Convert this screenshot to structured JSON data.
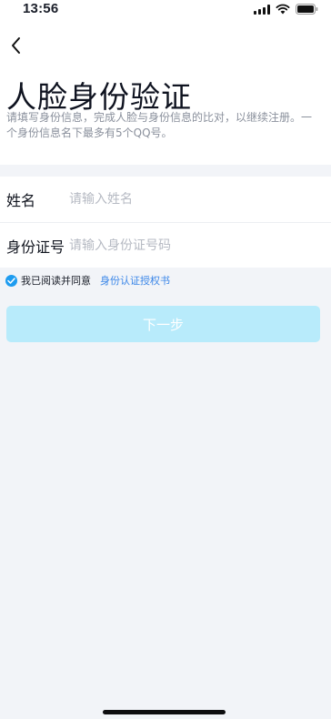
{
  "status_bar": {
    "time": "13:56",
    "icons": [
      "signal-icon",
      "wifi-icon",
      "battery-icon"
    ]
  },
  "header": {
    "back_icon": "chevron-left-icon",
    "title": "人脸身份验证",
    "description": "请填写身份信息，完成人脸与身份信息的比对，以继续注册。一个身份信息名下最多有5个QQ号。"
  },
  "form": {
    "name": {
      "label": "姓名",
      "placeholder": "请输入姓名",
      "value": ""
    },
    "id_number": {
      "label": "身份证号",
      "placeholder": "请输入身份证号码",
      "value": ""
    }
  },
  "agreement": {
    "checked": true,
    "text": "我已阅读并同意",
    "link_text": "身份认证授权书"
  },
  "next_button": {
    "label": "下一步",
    "enabled": false
  },
  "colors": {
    "accent": "#1e9cf0",
    "link": "#3a86e8",
    "button_disabled_bg": "#b8ebfb",
    "page_bg": "#f2f4f8"
  }
}
